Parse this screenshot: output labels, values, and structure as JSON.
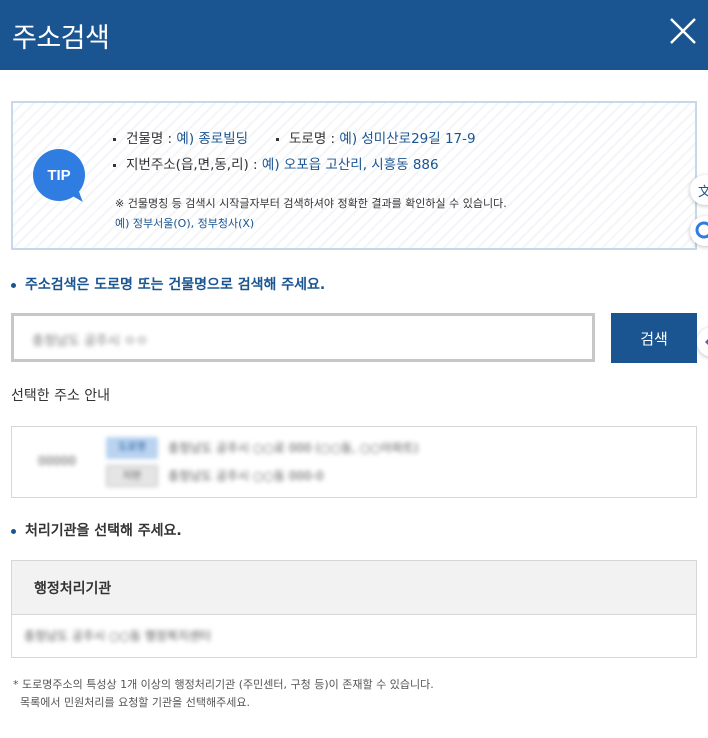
{
  "header": {
    "title": "주소검색",
    "background": "#1a5591"
  },
  "tip": {
    "badge": "TIP",
    "line1_a_label": "건물명 : ",
    "line1_a_example": "예) 종로빌딩",
    "line1_b_label": "도로명 : ",
    "line1_b_example": "예) 성미산로29길 17-9",
    "line2_label": "지번주소(읍,면,동,리) : ",
    "line2_example": "예) 오포읍 고산리, 시흥동 886",
    "note": "※ 건물명칭 등 검색시 시작글자부터 검색하셔야 정확한 결과를 확인하실 수 있습니다.",
    "note_example": "예) 정부서울(O), 정부청사(X)"
  },
  "side_widgets": {
    "translate_char": "文"
  },
  "search": {
    "guide": "주소검색은 도로명 또는 건물명으로 검색해 주세요.",
    "input_value": "충청남도 공주시 ㅇㅇ",
    "button_label": "검색"
  },
  "selected": {
    "label": "선택한 주소 안내",
    "zip": "00000",
    "road_tag": "도로명",
    "jibun_tag": "지번",
    "road_address": "충청남도 공주시 ○○로 000 (○○동, ○○아파트)",
    "jibun_address": "충청남도 공주시 ○○동 000-0"
  },
  "org": {
    "guide": "처리기관을 선택해 주세요.",
    "header": "행정처리기관",
    "row": "충청남도 공주시 ○○동 행정복지센터"
  },
  "footnote": {
    "line1": "* 도로명주소의 특성상 1개 이상의 행정처리기관 (주민센터, 구청 등)이 존재할 수 있습니다.",
    "line2": "목록에서 민원처리를 요청할 기관을 선택해주세요."
  }
}
